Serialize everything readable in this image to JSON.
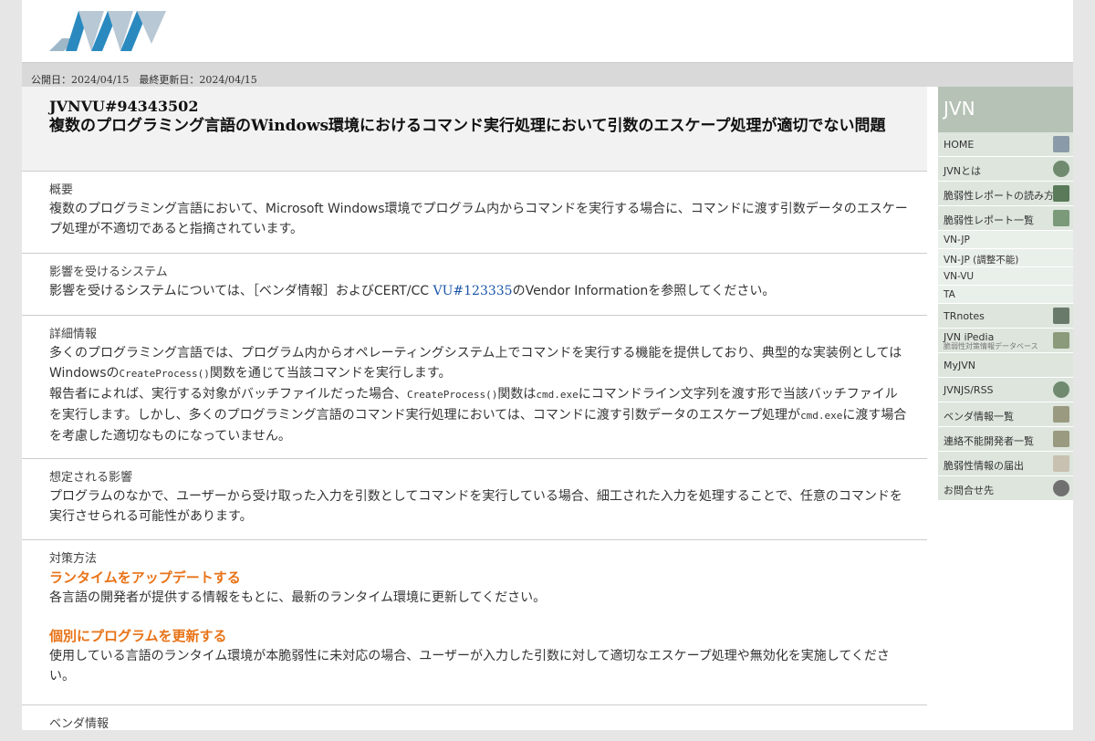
{
  "publish_bar": "公開日：2024/04/15　最終更新日：2024/04/15",
  "advisory": {
    "id": "JVNVU#94343502",
    "title": "複数のプログラミング言語のWindows環境におけるコマンド実行処理において引数のエスケープ処理が適切でない問題"
  },
  "sections": {
    "overview": {
      "label": "概要",
      "text": "複数のプログラミング言語において、Microsoft Windows環境でプログラム内からコマンドを実行する場合に、コマンドに渡す引数データのエスケープ処理が不適切であると指摘されています。"
    },
    "affected": {
      "label": "影響を受けるシステム",
      "text_before": "影響を受けるシステムについては、［ベンダ情報］およびCERT/CC ",
      "link": "VU#123335",
      "text_after": "のVendor Informationを参照してください。"
    },
    "details": {
      "label": "詳細情報",
      "p1_a": "多くのプログラミング言語では、プログラム内からオペレーティングシステム上でコマンドを実行する機能を提供しており、典型的な実装例としてはWindowsの",
      "p1_code": "CreateProcess()",
      "p1_b": "関数を通じて当該コマンドを実行します。",
      "p2_a": "報告者によれば、実行する対象がバッチファイルだった場合、",
      "p2_code1": "CreateProcess()",
      "p2_b": "関数は",
      "p2_code2": "cmd.exe",
      "p2_c": "にコマンドライン文字列を渡す形で当該バッチファイルを実行します。しかし、多くのプログラミング言語のコマンド実行処理においては、コマンドに渡す引数データのエスケープ処理が",
      "p2_code3": "cmd.exe",
      "p2_d": "に渡す場合を考慮した適切なものになっていません。"
    },
    "impact": {
      "label": "想定される影響",
      "text": "プログラムのなかで、ユーザーから受け取った入力を引数としてコマンドを実行している場合、細工された入力を処理することで、任意のコマンドを実行させられる可能性があります。"
    },
    "solution": {
      "label": "対策方法",
      "h1": "ランタイムをアップデートする",
      "t1": "各言語の開発者が提供する情報をもとに、最新のランタイム環境に更新してください。",
      "h2": "個別にプログラムを更新する",
      "t2": "使用している言語のランタイム環境が本脆弱性に未対応の場合、ユーザーが入力した引数に対して適切なエスケープ処理や無効化を実施してください。"
    },
    "vendor": {
      "label": "ベンダ情報"
    }
  },
  "sidebar": {
    "title": "JVN",
    "items": [
      {
        "label": "HOME",
        "icon": "building-icon",
        "color": "#8a9aa8"
      },
      {
        "label": "JVNとは",
        "icon": "globe-icon",
        "color": "#6f8a6f"
      },
      {
        "label": "脆弱性レポートの読み方",
        "icon": "eye-icon",
        "color": "#5a7a5a"
      },
      {
        "label": "脆弱性レポート一覧",
        "icon": "list-icon",
        "color": "#7a9a7a"
      }
    ],
    "sub_items": [
      "VN-JP",
      "VN-JP (調整不能)",
      "VN-VU",
      "TA"
    ],
    "items2": [
      {
        "label": "TRnotes",
        "icon": "pin-icon",
        "color": "#6a7a6a"
      },
      {
        "label": "JVN iPedia",
        "sub": "脆弱性対策情報データベース",
        "icon": "pattern-icon",
        "color": "#8a9a7a"
      },
      {
        "label": "MyJVN"
      },
      {
        "label": "JVNJS/RSS",
        "icon": "globe-icon",
        "color": "#6f8a6f"
      },
      {
        "label": "ベンダ情報一覧",
        "icon": "hand-icon",
        "color": "#9a9a80"
      },
      {
        "label": "連絡不能開発者一覧",
        "icon": "hand-icon",
        "color": "#9a9a80"
      },
      {
        "label": "脆弱性情報の届出",
        "icon": "document-icon",
        "color": "#c8c0b0"
      },
      {
        "label": "お問合せ先",
        "icon": "contact-icon",
        "color": "#707070"
      }
    ]
  }
}
